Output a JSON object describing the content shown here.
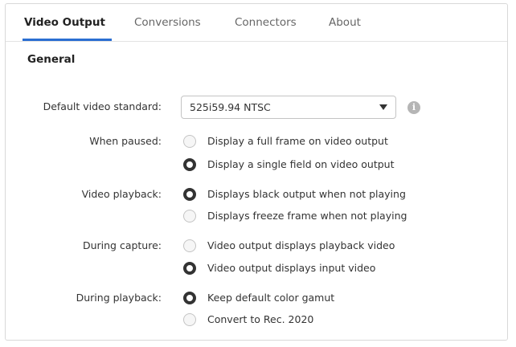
{
  "tabs": [
    {
      "label": "Video Output",
      "active": true
    },
    {
      "label": "Conversions",
      "active": false
    },
    {
      "label": "Connectors",
      "active": false
    },
    {
      "label": "About",
      "active": false
    }
  ],
  "section_title": "General",
  "default_video_standard": {
    "label": "Default video standard:",
    "value": "525i59.94 NTSC",
    "info_icon": "info-icon"
  },
  "when_paused": {
    "label": "When paused:",
    "options": [
      {
        "label": "Display a full frame on video output",
        "selected": false
      },
      {
        "label": "Display a single field on video output",
        "selected": true
      }
    ]
  },
  "video_playback": {
    "label": "Video playback:",
    "options": [
      {
        "label": "Displays black output when not playing",
        "selected": true
      },
      {
        "label": "Displays freeze frame when not playing",
        "selected": false
      }
    ]
  },
  "during_capture": {
    "label": "During capture:",
    "options": [
      {
        "label": "Video output displays playback video",
        "selected": false
      },
      {
        "label": "Video output displays input video",
        "selected": true
      }
    ]
  },
  "during_playback": {
    "label": "During playback:",
    "options": [
      {
        "label": "Keep default color gamut",
        "selected": true
      },
      {
        "label": "Convert to Rec. 2020",
        "selected": false
      }
    ]
  },
  "colors": {
    "accent": "#2b6ed2",
    "border": "#d9d9d9",
    "text": "#333333"
  }
}
